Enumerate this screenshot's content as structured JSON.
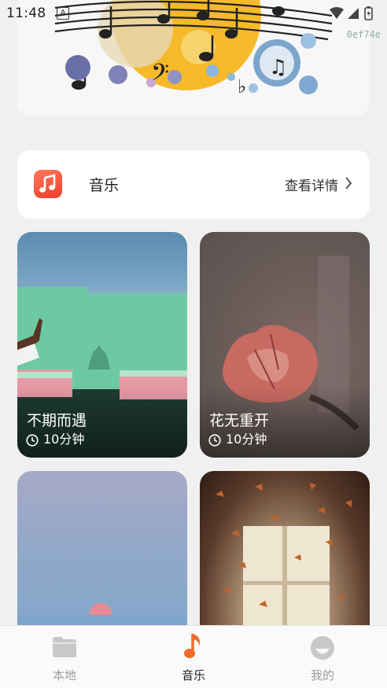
{
  "status_bar": {
    "time": "11:48",
    "notification_letter": "A",
    "build_hash": "0ef74e"
  },
  "header": {
    "illustration": "music-notes-illustration"
  },
  "music_card": {
    "icon": "music-note-icon",
    "title": "音乐",
    "detail_label": "查看详情",
    "accent": "#f5452f"
  },
  "cards": [
    {
      "title": "不期而遇",
      "duration": "10分钟"
    },
    {
      "title": "花无重开",
      "duration": "10分钟"
    },
    {
      "title": "",
      "duration": ""
    },
    {
      "title": "",
      "duration": ""
    }
  ],
  "tabbar": {
    "items": [
      {
        "label": "本地",
        "icon": "folder-icon",
        "active": false
      },
      {
        "label": "音乐",
        "icon": "music-note-icon",
        "active": true
      },
      {
        "label": "我的",
        "icon": "profile-icon",
        "active": false
      }
    ],
    "active_color": "#f26b2a",
    "inactive_color": "#c8c8c8"
  }
}
